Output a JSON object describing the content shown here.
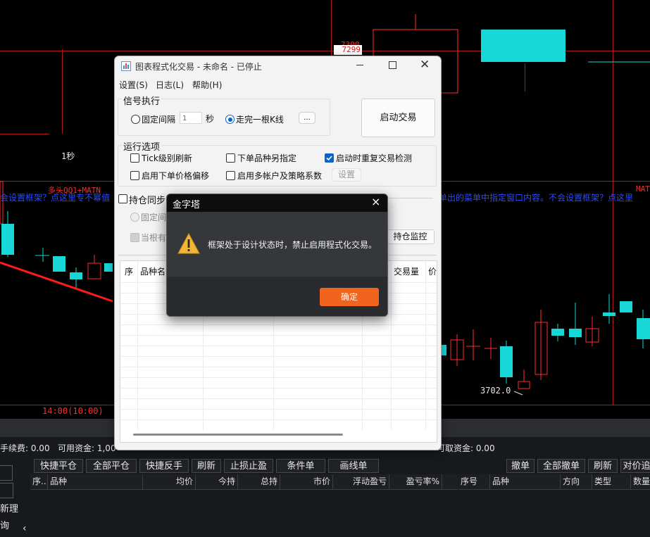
{
  "chart": {
    "price_tag": "7299",
    "price_tag_partial": "7300",
    "interval_label": "1秒",
    "indicator_label": "多头QQ1+MATN",
    "indicator_label_right": "MATN",
    "marquee_left": "会设置框架？点这里专不幂值",
    "marquee_right": "单出的菜单中指定窗口内容。不会设置框架？点这里",
    "low_label": "3702.0",
    "time_label": "14:00(10:00)",
    "colors": {
      "up": "#ff2b2b",
      "down": "#18d7d7",
      "grid": "#b01818",
      "trendline": "#ff1a1a",
      "marquee": "#2a4bff"
    }
  },
  "bottom": {
    "fee": "手续费: 0.00",
    "available": "可用资金: 1,00",
    "available_tail": "可取资金: 0.00",
    "side_label_1": "新理",
    "side_label_2": "询",
    "buttons": [
      "快捷平仓",
      "全部平仓",
      "快捷反手",
      "刷新",
      "止损止盈",
      "条件单",
      "画线单"
    ],
    "right_buttons": [
      "撤单",
      "全部撤单",
      "刷新",
      "对价追"
    ],
    "positions_headers": [
      "序..",
      "品种",
      "均价",
      "今持",
      "总持",
      "市价",
      "浮动盈亏",
      "盈亏率%"
    ],
    "orders_headers": [
      "序号",
      "品种",
      "方向",
      "类型",
      "数量"
    ]
  },
  "window": {
    "title": "图表程式化交易 - 未命名 - 已停止",
    "menu": [
      "设置(S)",
      "日志(L)",
      "帮助(H)"
    ],
    "signal_group": "信号执行",
    "fixed_interval": "固定间隔",
    "interval_value": "1",
    "seconds": "秒",
    "bar_complete": "走完一根K线",
    "ellipsis": "...",
    "start_button": "启动交易",
    "run_group": "运行选项",
    "opt_tick": "Tick级别刷新",
    "opt_order_symbol": "下单品种另指定",
    "opt_dup_check": "启动时重复交易检测",
    "opt_price_offset": "启用下单价格偏移",
    "opt_multi_account": "启用多帐户及策略系数",
    "settings_button": "设置",
    "pos_sync": "持仓同步",
    "pos_fixed": "固定间",
    "pos_current": "当根有",
    "monitor_button": "持仓监控",
    "table_headers": [
      "序",
      "品种名",
      "交易量",
      "价"
    ]
  },
  "alert": {
    "title": "金字塔",
    "message": "框架处于设计状态时，禁止启用程式化交易。",
    "ok": "确定",
    "close_glyph": "×"
  }
}
